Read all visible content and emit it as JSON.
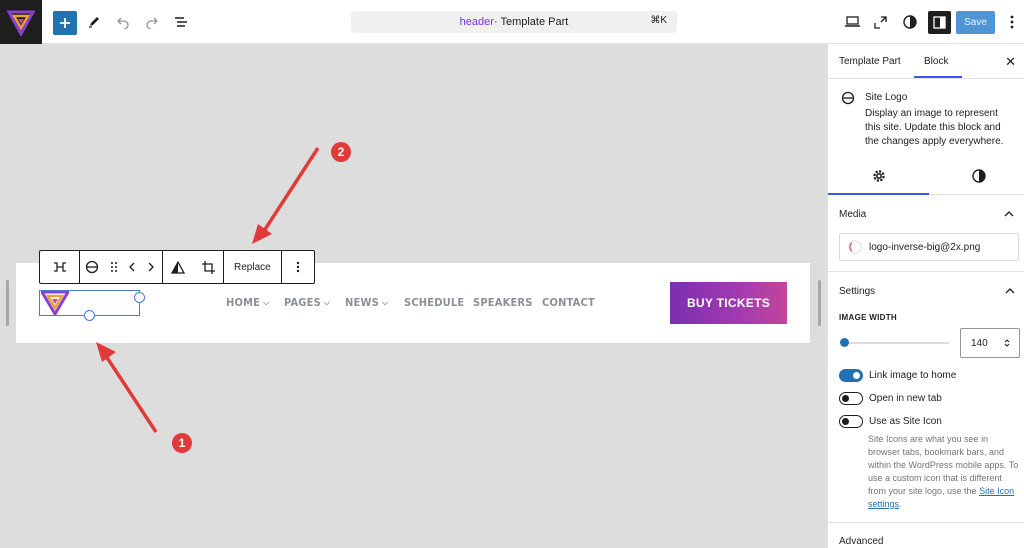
{
  "topbar": {
    "document_title_part": "header",
    "document_title_rest": " · Template Part",
    "shortcut": "⌘K",
    "save_label": "Save"
  },
  "canvas": {
    "nav_items": [
      {
        "label": "HOME",
        "has_submenu": true
      },
      {
        "label": "PAGES",
        "has_submenu": true
      },
      {
        "label": "NEWS",
        "has_submenu": true
      },
      {
        "label": "SCHEDULE",
        "has_submenu": false
      },
      {
        "label": "SPEAKERS",
        "has_submenu": false
      },
      {
        "label": "CONTACT",
        "has_submenu": false
      }
    ],
    "cta_label": "BUY TICKETS",
    "block_toolbar": {
      "replace_label": "Replace"
    },
    "annotations": [
      "1",
      "2"
    ]
  },
  "sidebar": {
    "tabs": [
      "Template Part",
      "Block"
    ],
    "active_tab": "Block",
    "block": {
      "title": "Site Logo",
      "description": "Display an image to represent this site. Update this block and the changes apply everywhere."
    },
    "media": {
      "title": "Media",
      "file_name": "logo-inverse-big@2x.png"
    },
    "settings": {
      "title": "Settings",
      "image_width_label": "IMAGE WIDTH",
      "image_width_value": "140",
      "toggles": [
        {
          "label": "Link image to home",
          "on": true
        },
        {
          "label": "Open in new tab",
          "on": false
        },
        {
          "label": "Use as Site Icon",
          "on": false
        }
      ],
      "help_text": "Site Icons are what you see in browser tabs, bookmark bars, and within the WordPress mobile apps. To use a custom icon that is different from your site logo, use the ",
      "help_link": "Site Icon settings",
      "help_end": "."
    },
    "advanced_title": "Advanced"
  },
  "colors": {
    "accent": "#3858e9",
    "cta_gradient_start": "#7b2fb0",
    "cta_gradient_end": "#c4449c",
    "annotation": "#e03a3a"
  }
}
